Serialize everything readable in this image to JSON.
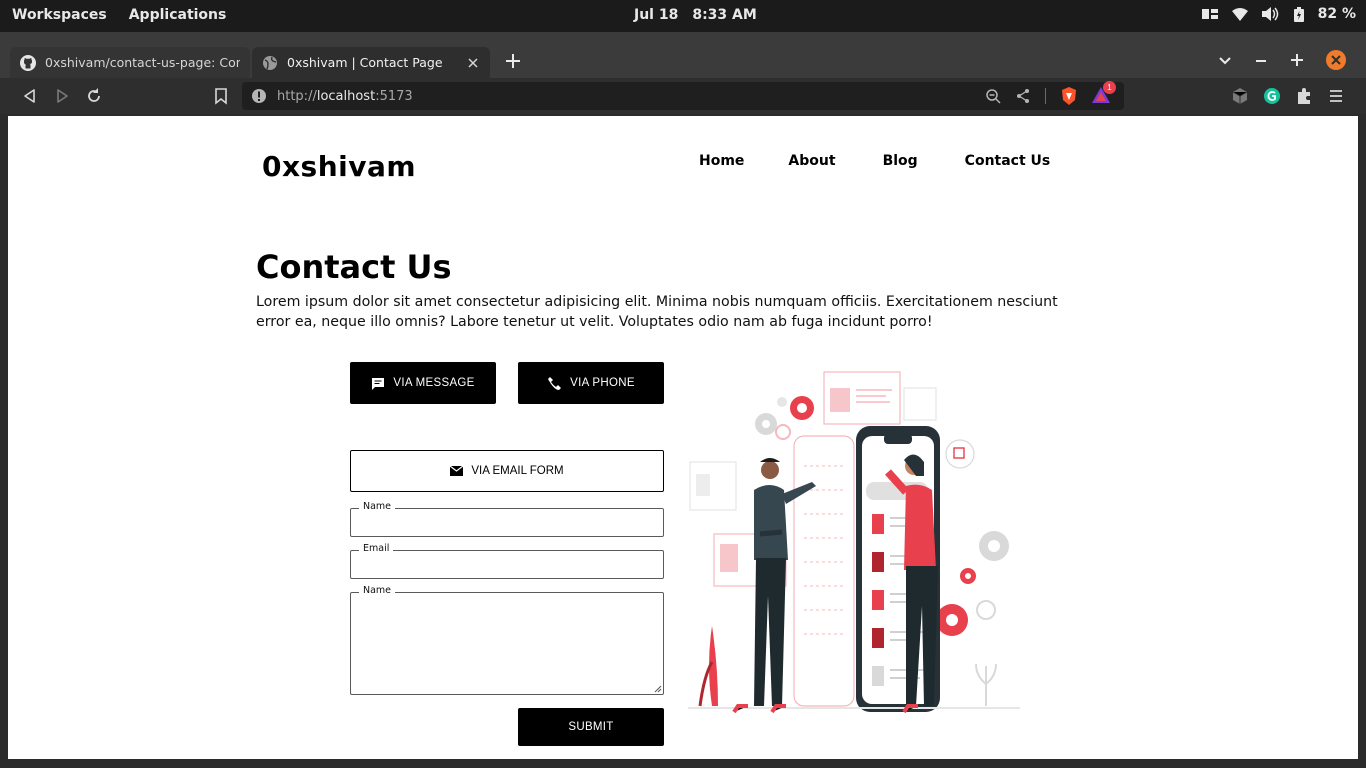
{
  "os": {
    "workspaces": "Workspaces",
    "applications": "Applications",
    "date": "Jul 18",
    "time": "8:33 AM",
    "battery": "82 %"
  },
  "browser": {
    "tabs": [
      {
        "title": "0xshivam/contact-us-page: Contac",
        "icon": "github-icon",
        "active": false
      },
      {
        "title": "0xshivam | Contact Page",
        "icon": "globe-icon",
        "active": true
      }
    ],
    "url_prefix": "http://",
    "url_host": "localhost",
    "url_suffix": ":5173",
    "notification_count": "1",
    "accent": "#f07c2b"
  },
  "site": {
    "logo": "0xshivam",
    "nav": [
      "Home",
      "About",
      "Blog",
      "Contact Us"
    ]
  },
  "contact": {
    "title": "Contact Us",
    "intro": "Lorem ipsum dolor sit amet consectetur adipisicing elit. Minima nobis numquam officiis. Exercitationem nesciunt error ea, neque illo omnis? Labore tenetur ut velit. Voluptates odio nam ab fuga incidunt porro!",
    "via_message": "VIA MESSAGE",
    "via_phone": "VIA PHONE",
    "via_email": "VIA EMAIL FORM",
    "fields": {
      "name_label": "Name",
      "email_label": "Email",
      "message_label": "Name"
    },
    "submit": "SUBMIT"
  },
  "colors": {
    "illustration_red": "#e8404c",
    "illustration_dark": "#263238"
  }
}
